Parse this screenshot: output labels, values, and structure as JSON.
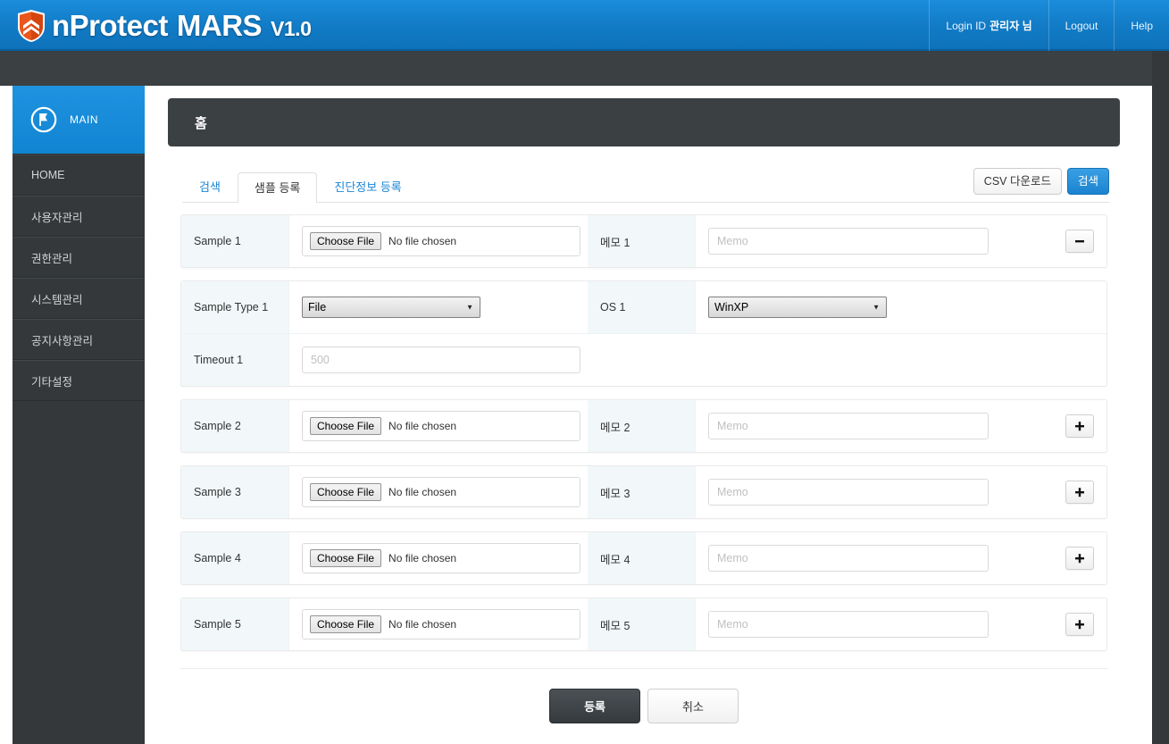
{
  "header": {
    "brand_n": "n",
    "brand_protect": "Protect",
    "brand_mars": "MARS",
    "brand_version": "V1.0",
    "logo_icon": "shield-icon",
    "accent_color": "#1184d2",
    "login_label": "Login ID",
    "login_user": "관리자 님",
    "logout_label": "Logout",
    "help_label": "Help"
  },
  "sidebar": {
    "main_label": "MAIN",
    "main_icon": "main-circle-icon",
    "items": [
      {
        "label": "HOME"
      },
      {
        "label": "사용자관리"
      },
      {
        "label": "권한관리"
      },
      {
        "label": "시스템관리"
      },
      {
        "label": "공지사항관리"
      },
      {
        "label": "기타설정"
      }
    ]
  },
  "panel": {
    "title": "홈"
  },
  "tabs": [
    {
      "label": "검색",
      "active": false
    },
    {
      "label": "샘플 등록",
      "active": true
    },
    {
      "label": "진단정보 등록",
      "active": false
    }
  ],
  "tab_actions": {
    "csv_label": "CSV 다운로드",
    "search_label": "검색"
  },
  "form": {
    "memo_placeholder": "Memo",
    "file_button_label": "Choose File",
    "file_status": "No file chosen",
    "sample1": {
      "label": "Sample 1",
      "memo_label": "메모 1",
      "memo_value": "",
      "action_icon": "minus-icon"
    },
    "sample1_detail": {
      "type_label": "Sample Type 1",
      "type_value": "File",
      "os_label": "OS 1",
      "os_value": "WinXP",
      "timeout_label": "Timeout 1",
      "timeout_placeholder": "500",
      "timeout_value": ""
    },
    "rows": [
      {
        "label": "Sample 2",
        "memo_label": "메모 2",
        "memo_value": "",
        "action_icon": "plus-icon"
      },
      {
        "label": "Sample 3",
        "memo_label": "메모 3",
        "memo_value": "",
        "action_icon": "plus-icon"
      },
      {
        "label": "Sample 4",
        "memo_label": "메모 4",
        "memo_value": "",
        "action_icon": "plus-icon"
      },
      {
        "label": "Sample 5",
        "memo_label": "메모 5",
        "memo_value": "",
        "action_icon": "plus-icon"
      }
    ]
  },
  "footer": {
    "submit_label": "등록",
    "cancel_label": "취소"
  }
}
